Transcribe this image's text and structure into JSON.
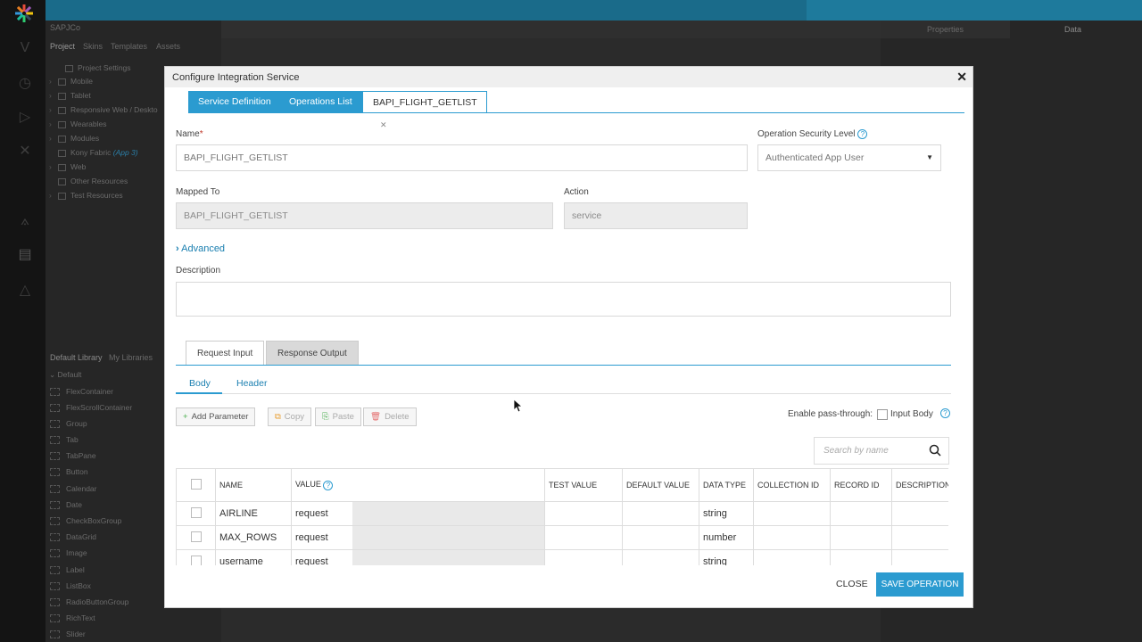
{
  "ide": {
    "project_name": "SAPJCo",
    "panel_tabs": [
      "Project",
      "Skins",
      "Templates",
      "Assets"
    ],
    "tree": [
      "Project Settings",
      "Mobile",
      "Tablet",
      "Responsive Web / Deskto",
      "Wearables",
      "Modules",
      "Kony Fabric",
      "Web",
      "Other Resources",
      "Test Resources"
    ],
    "tree_badge": "(App 3)",
    "library_tabs": [
      "Default Library",
      "My Libraries"
    ],
    "library_root": "Default",
    "library_items": [
      "FlexContainer",
      "FlexScrollContainer",
      "Group",
      "Tab",
      "TabPane",
      "Button",
      "Calendar",
      "Date",
      "CheckBoxGroup",
      "DataGrid",
      "Image",
      "Label",
      "ListBox",
      "RadioButtonGroup",
      "RichText",
      "Slider"
    ],
    "right_tabs": [
      "Properties",
      "Data"
    ]
  },
  "modal": {
    "title": "Configure Integration Service",
    "tabs": [
      "Service Definition",
      "Operations List",
      "BAPI_FLIGHT_GETLIST"
    ],
    "name_label": "Name",
    "name_value": "BAPI_FLIGHT_GETLIST",
    "security_label": "Operation Security Level",
    "security_value": "Authenticated App User",
    "mapped_label": "Mapped To",
    "mapped_value": "BAPI_FLIGHT_GETLIST",
    "action_label": "Action",
    "action_value": "service",
    "advanced_label": "Advanced",
    "description_label": "Description",
    "description_value": "",
    "io_tabs": [
      "Request Input",
      "Response Output"
    ],
    "body_tabs": [
      "Body",
      "Header"
    ],
    "toolbar": {
      "add": "Add Parameter",
      "copy": "Copy",
      "paste": "Paste",
      "delete": "Delete",
      "pass_label": "Enable pass-through:",
      "pass_input": "Input Body"
    },
    "search_placeholder": "Search by name",
    "columns": [
      "NAME",
      "VALUE",
      "TEST VALUE",
      "DEFAULT VALUE",
      "DATA TYPE",
      "COLLECTION ID",
      "RECORD ID",
      "DESCRIPTION"
    ],
    "rows": [
      {
        "name": "AIRLINE",
        "value": "request",
        "type": "string"
      },
      {
        "name": "MAX_ROWS",
        "value": "request",
        "type": "number"
      },
      {
        "name": "username",
        "value": "request",
        "type": "string"
      }
    ],
    "close_label": "CLOSE",
    "save_label": "SAVE OPERATION"
  },
  "colors": {
    "accent": "#2b9bd0",
    "topbar": "#1a6b8a"
  }
}
